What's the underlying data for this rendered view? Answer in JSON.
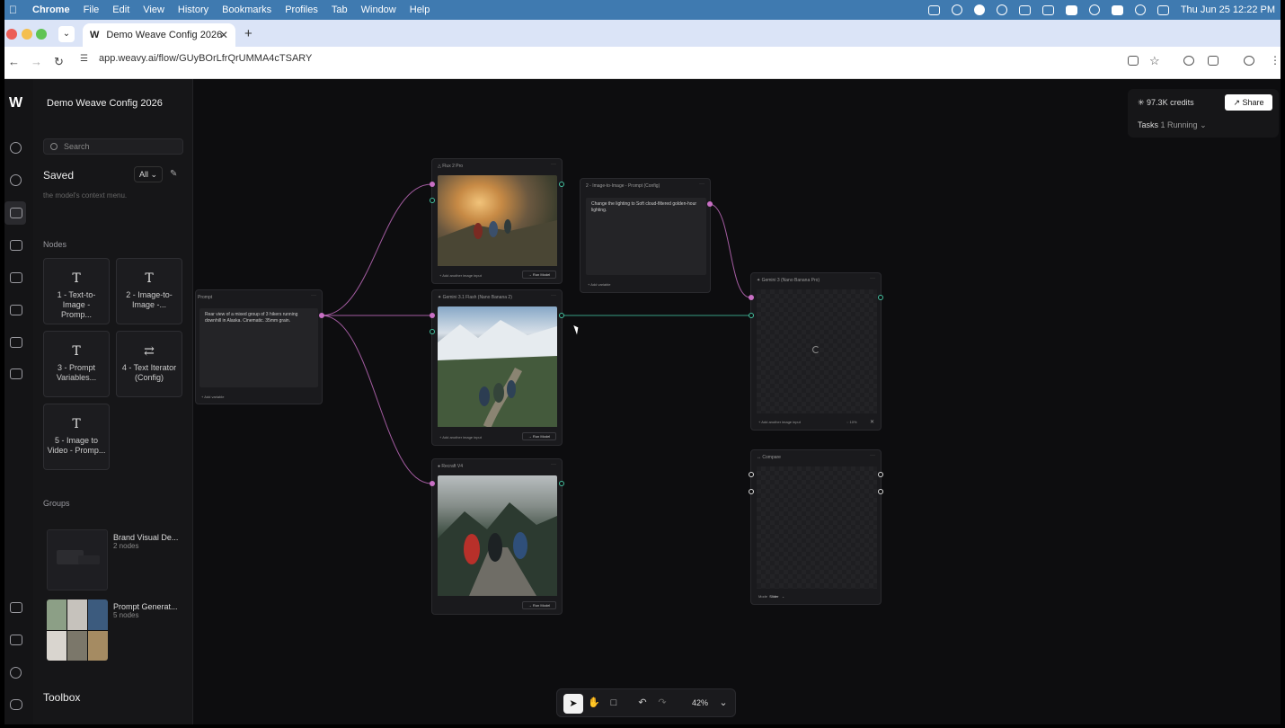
{
  "menubar": {
    "app": "Chrome",
    "items": [
      "File",
      "Edit",
      "View",
      "History",
      "Bookmarks",
      "Profiles",
      "Tab",
      "Window",
      "Help"
    ],
    "clock": "Thu Jun 25  12:22 PM"
  },
  "browser": {
    "tab_title": "Demo Weave Config 2026",
    "url": "app.weavy.ai/flow/GUyBOrLfrQrUMMA4cTSARY"
  },
  "sidebar": {
    "project_title": "Demo Weave Config 2026",
    "search_placeholder": "Search",
    "saved_label": "Saved",
    "filter_value": "All",
    "context_hint": "the model's context menu.",
    "nodes_heading": "Nodes",
    "nodes": [
      {
        "label": "1 - Text-to-Image - Promp..."
      },
      {
        "label": "2 - Image-to-Image -..."
      },
      {
        "label": "3 - Prompt Variables..."
      },
      {
        "label": "4 - Text Iterator (Config)"
      },
      {
        "label": "5 - Image to Video - Promp..."
      }
    ],
    "groups_heading": "Groups",
    "groups": [
      {
        "name": "Brand Visual De...",
        "count": "2 nodes"
      },
      {
        "name": "Prompt Generat...",
        "count": "5 nodes"
      }
    ],
    "toolbox_label": "Toolbox"
  },
  "topright": {
    "credits": "97.3K credits",
    "share_label": "Share",
    "tasks_label": "Tasks",
    "tasks_status": "1 Running"
  },
  "canvas": {
    "prompt_node": {
      "title": "Prompt",
      "text": "Rear view of a mixed group of 3 hikers running downhill in Alaska. Cinematic. 35mm grain.",
      "add_variable": "+ Add variable"
    },
    "flux_node": {
      "title": "Flux 2 Pro",
      "add_input": "+ Add another image input",
      "run": "→ Run Model"
    },
    "i2i_prompt_node": {
      "title": "2 - Image-to-Image - Prompt (Config)",
      "text": "Change the lighting to Soft cloud-filtered golden-hour lighting.",
      "add_variable": "+ Add variable"
    },
    "gemini_flash_node": {
      "title": "Gemini 3.1 Flash (Nano Banana 2)",
      "add_input": "+ Add another image input",
      "run": "→ Run Model"
    },
    "recraft_node": {
      "title": "Recraft V4",
      "run": "→ Run Model"
    },
    "gemini_pro_node": {
      "title": "Gemini 3 (Nano Banana Pro)",
      "add_input": "+ Add another image input",
      "progress": "10%"
    },
    "compare_node": {
      "title": "Compare",
      "mode_label": "Mode",
      "mode_value": "Slider"
    }
  },
  "bottom_toolbar": {
    "zoom": "42%"
  },
  "colors": {
    "menubar": "#3f7ab0",
    "canvas": "#0d0d0f",
    "edge_pink": "#c86fc4",
    "edge_teal": "#44c2a0"
  }
}
